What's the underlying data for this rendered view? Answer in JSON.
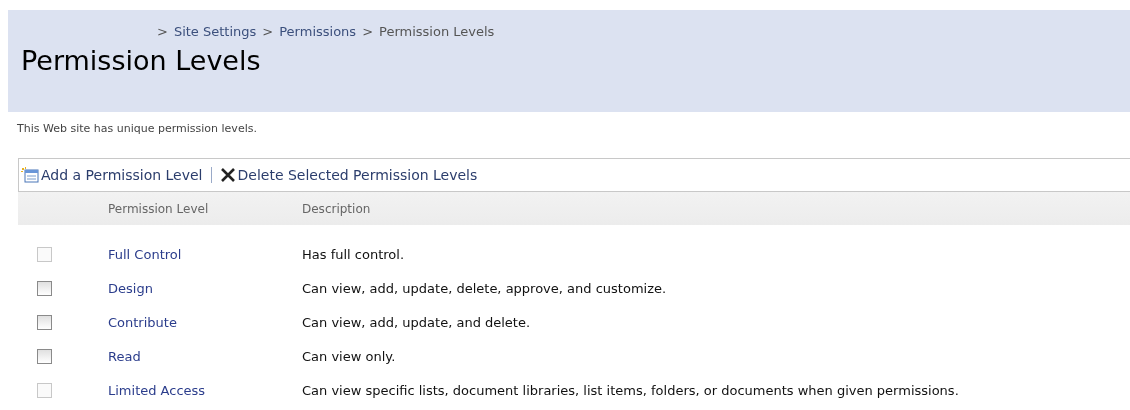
{
  "breadcrumb": [
    {
      "label": ">",
      "kind": "separator"
    },
    {
      "label": "Site Settings",
      "kind": "link"
    },
    {
      "label": ">",
      "kind": "separator"
    },
    {
      "label": "Permissions",
      "kind": "link"
    },
    {
      "label": ">",
      "kind": "separator"
    },
    {
      "label": "Permission Levels",
      "kind": "current"
    }
  ],
  "title": "Permission Levels",
  "intro": "This Web site has unique permission levels.",
  "toolbar": [
    {
      "label": "Add a Permission Level",
      "kind": "add"
    },
    {
      "label": "Delete Selected Permission Levels",
      "kind": "delete"
    }
  ],
  "table": {
    "columns": [
      "Permission Level",
      "Description"
    ],
    "rows": [
      {
        "name": "Full Control",
        "description": "Has full control.",
        "checked": false,
        "disabled": true
      },
      {
        "name": "Design",
        "description": "Can view, add, update, delete, approve, and customize.",
        "checked": false,
        "disabled": false
      },
      {
        "name": "Contribute",
        "description": "Can view, add, update, and delete.",
        "checked": false,
        "disabled": false
      },
      {
        "name": "Read",
        "description": "Can view only.",
        "checked": false,
        "disabled": false
      },
      {
        "name": "Limited Access",
        "description": "Can view specific lists, document libraries, list items, folders, or documents when given permissions.",
        "checked": false,
        "disabled": true
      }
    ]
  }
}
